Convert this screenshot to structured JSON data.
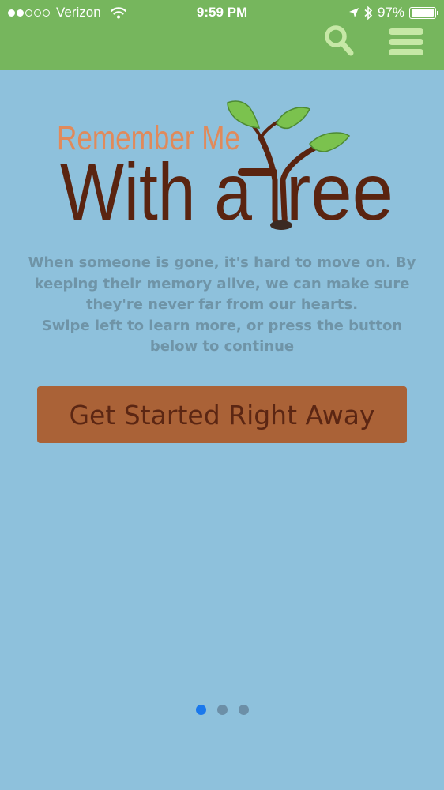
{
  "status_bar": {
    "carrier": "Verizon",
    "time": "9:59 PM",
    "battery": "97%",
    "battery_level": 0.97,
    "signal_bars_filled": 2,
    "signal_bars_total": 5
  },
  "nav": {
    "search_icon": "search-icon",
    "menu_icon": "hamburger-menu-icon"
  },
  "logo": {
    "line1": "Remember Me",
    "line2_a": "With a",
    "line2_b": "ree"
  },
  "intro": {
    "line1": "When someone is gone, it's hard to move on. By keeping their memory alive, we can make sure they're never far from our hearts.",
    "line2": "Swipe left to learn more, or press the button below to continue"
  },
  "cta": {
    "label": "Get Started Right Away"
  },
  "pager": {
    "count": 3,
    "active_index": 0
  },
  "colors": {
    "header_bg": "#76b65d",
    "icon_green": "#c6e8a6",
    "page_bg": "#8ec1dc",
    "text_muted": "#6f94a7",
    "button_bg": "#aa6237",
    "button_text": "#5b2613",
    "logo_orange": "#e08a5b",
    "logo_brown": "#5a2410",
    "pager_active": "#1a78ec",
    "pager_inactive": "#6c8fa7"
  }
}
